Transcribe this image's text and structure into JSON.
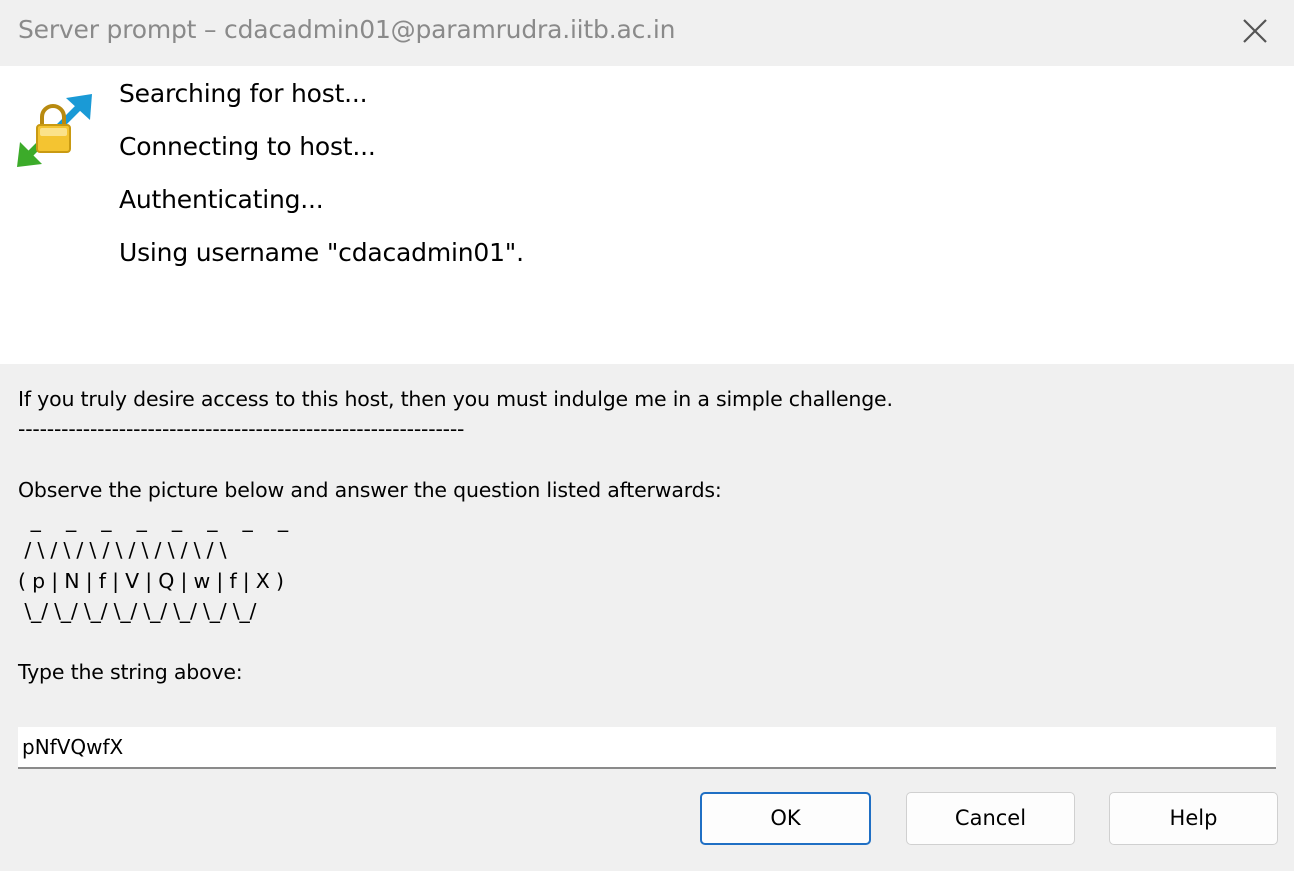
{
  "window": {
    "title": "Server prompt – cdacadmin01@paramrudra.iitb.ac.in",
    "accent_color": "#1f6fc4"
  },
  "icons": {
    "app": "lock-connection-icon",
    "close": "close-icon"
  },
  "status_lines": [
    "Searching for host...",
    "Connecting to host...",
    "Authenticating...",
    "Using username \"cdacadmin01\"."
  ],
  "prompt": {
    "text": "If you truly desire access to this host, then you must indulge me in a simple challenge.\n--------------------------------------------------------------\n\nObserve the picture below and answer the question listed afterwards:\n  _    _    _    _    _    _    _    _ \n / \\ / \\ / \\ / \\ / \\ / \\ / \\ / \\\n( p | N | f | V | Q | w | f | X )\n \\_/ \\_/ \\_/ \\_/ \\_/ \\_/ \\_/ \\_/\n\nType the string above:"
  },
  "answer_input": {
    "value": "pNfVQwfX"
  },
  "buttons": {
    "ok": "OK",
    "cancel": "Cancel",
    "help": "Help"
  }
}
